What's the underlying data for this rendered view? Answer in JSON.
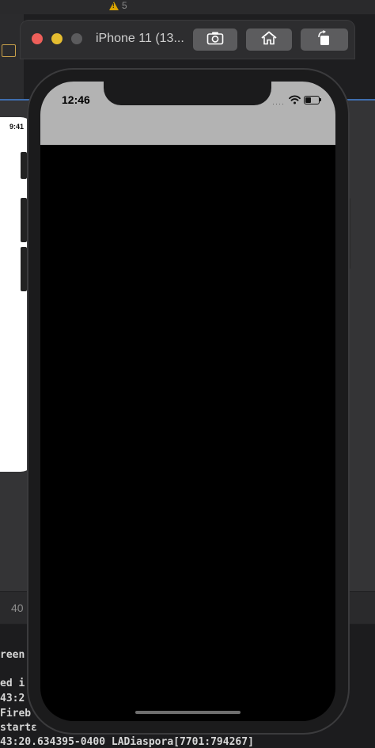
{
  "xcode": {
    "warning_count": "5",
    "storyboard_time": "9:41",
    "zoom_label": "40",
    "console_lines": [
      "reen",
      "ed i",
      "43:2",
      "Fireb",
      " startε",
      "43:20.634395-0400 LADiaspora[7701:794267]"
    ]
  },
  "simulator": {
    "title": "iPhone 11 (13...",
    "toolbar_icons": [
      "screenshot-icon",
      "home-icon",
      "rotate-icon"
    ],
    "colors": {
      "close": "#ee5f5a",
      "minimize": "#e5bd30",
      "zoom_disabled": "#5b5b5d"
    }
  },
  "device": {
    "status_time": "12:46",
    "status_bar_color": "#b3b3b3",
    "screen_color": "#000000"
  }
}
